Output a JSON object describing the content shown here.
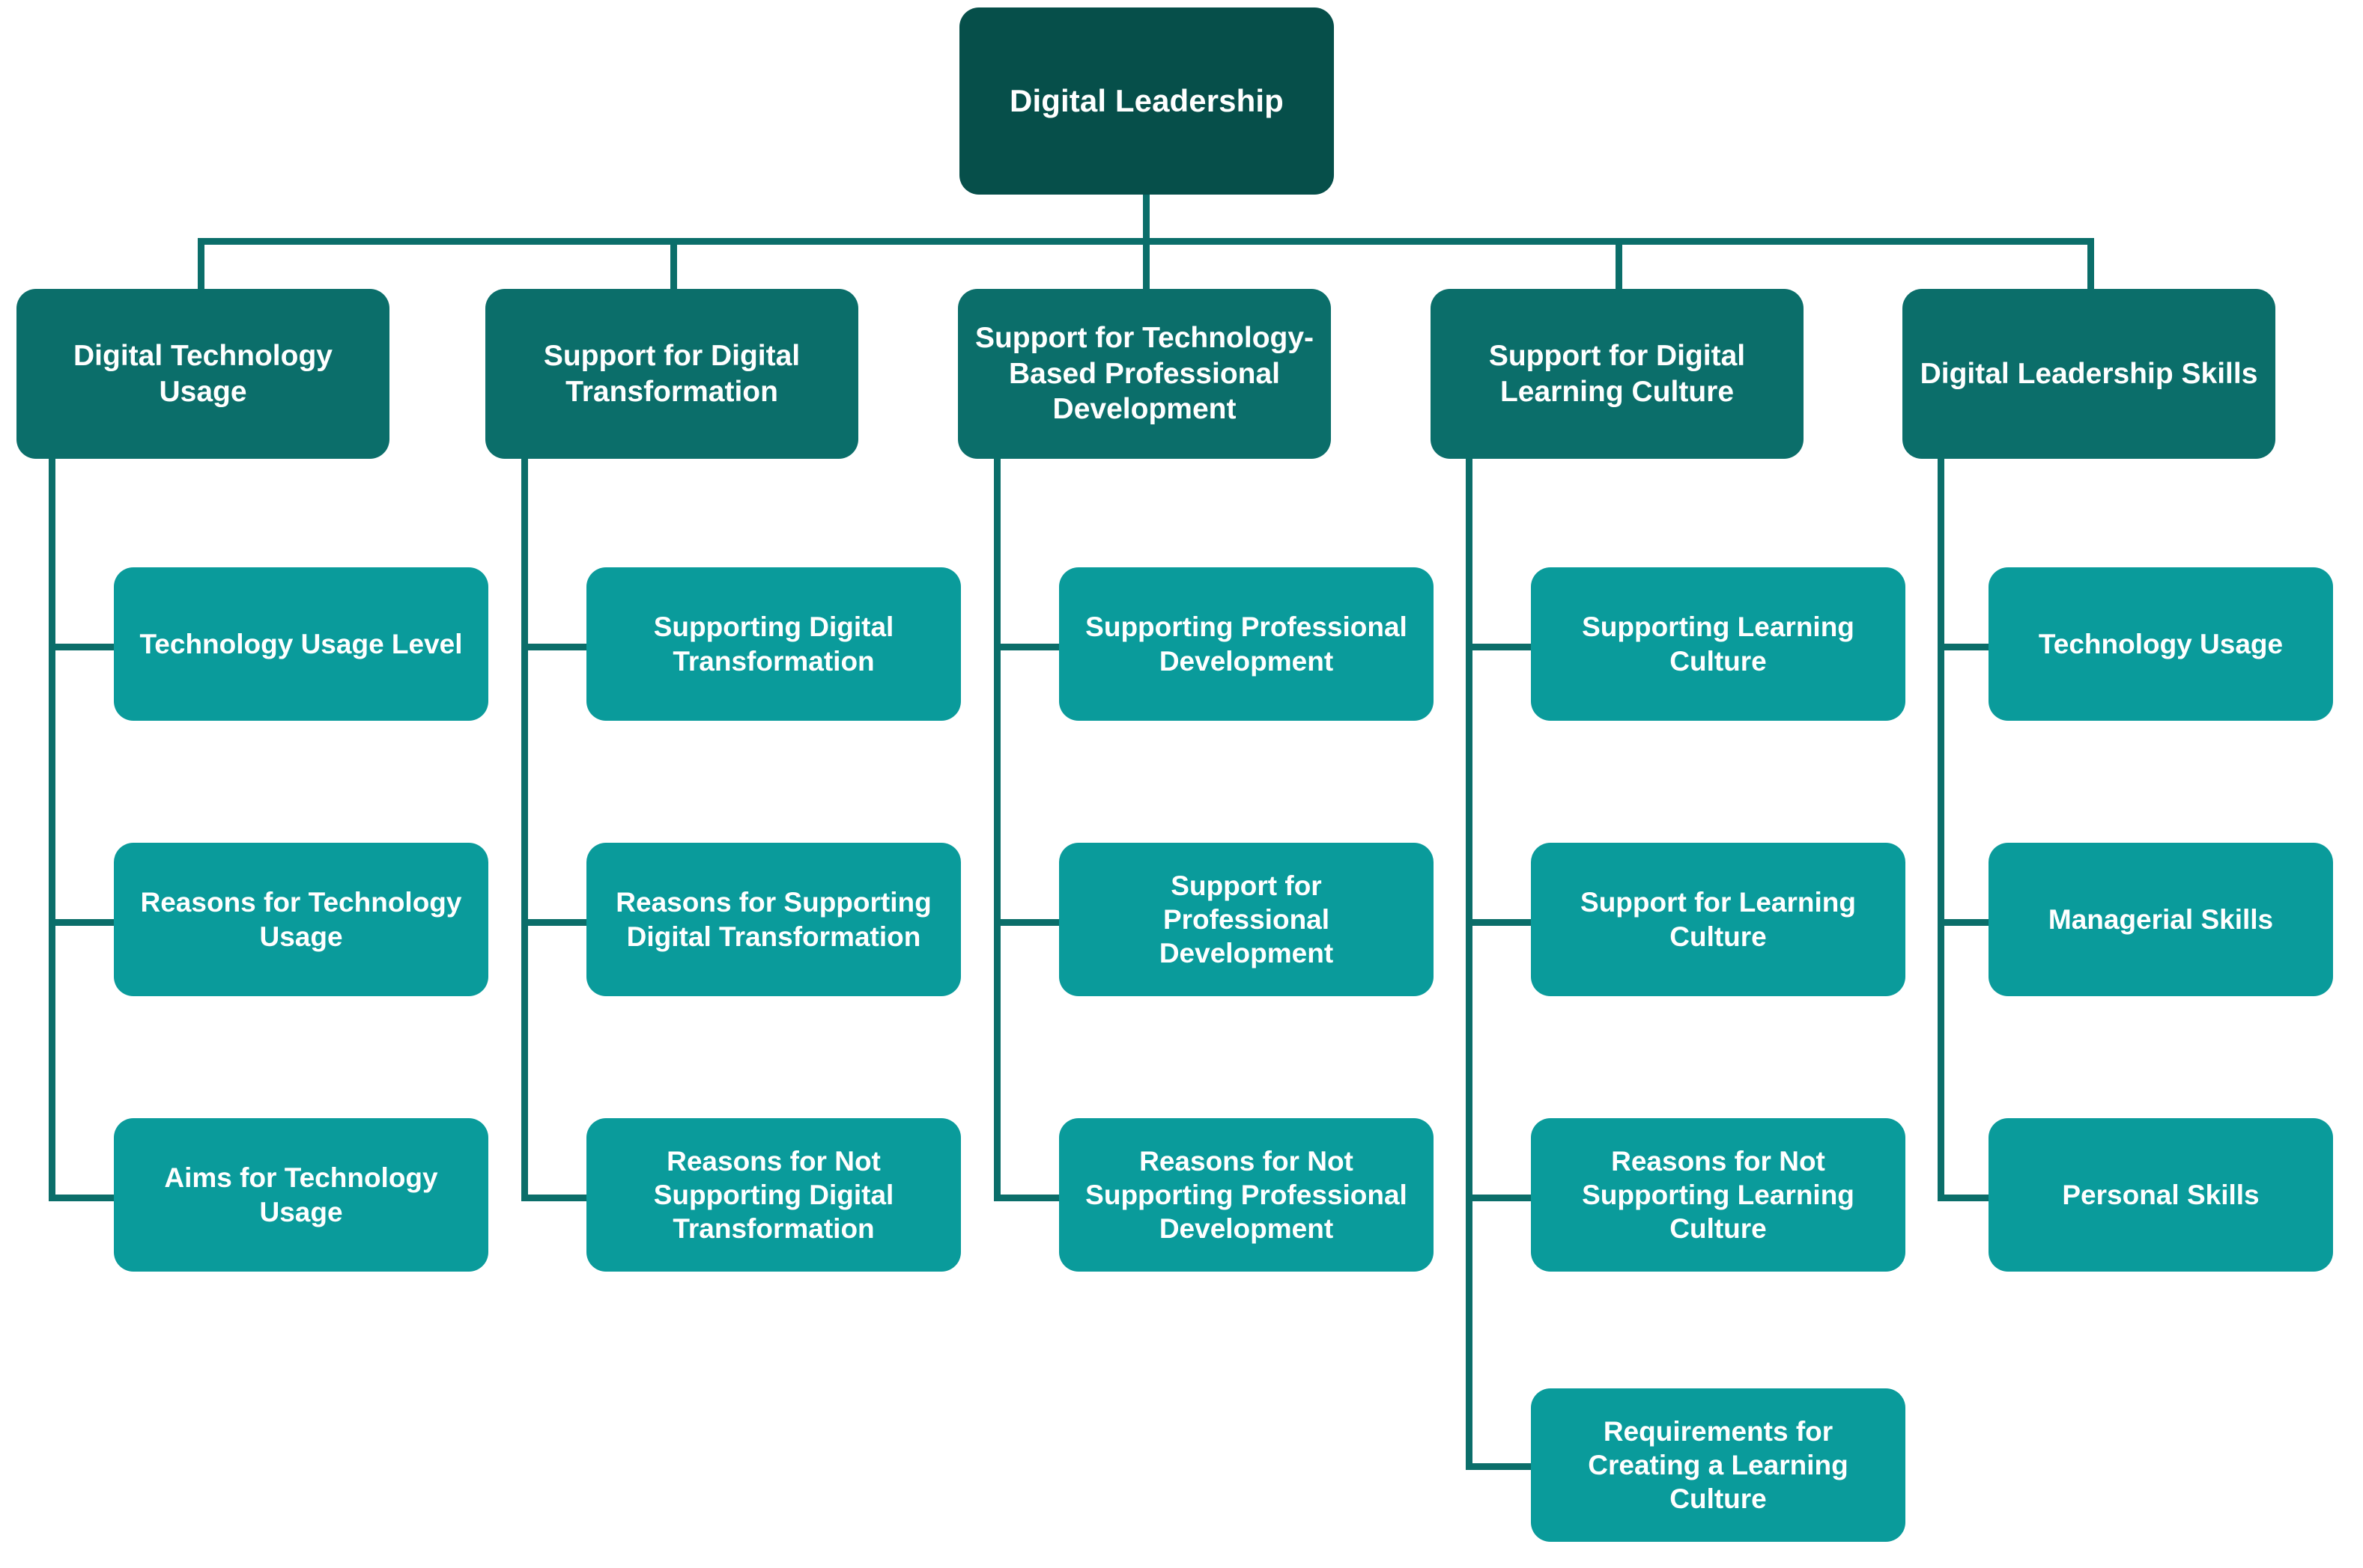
{
  "diagram": {
    "type": "organizational-tree",
    "title_node": "Digital Leadership",
    "colors": {
      "root": "#064f4a",
      "level2": "#0b6e6a",
      "level3": "#0a9b9b",
      "connector": "#0b6e6a",
      "text": "#ffffff",
      "background": "#ffffff"
    },
    "root": {
      "label": "Digital Leadership"
    },
    "branches": [
      {
        "label": "Digital Technology\nUsage",
        "children": [
          {
            "label": "Technology Usage Level"
          },
          {
            "label": "Reasons for Technology\nUsage"
          },
          {
            "label": "Aims for Technology\nUsage"
          }
        ]
      },
      {
        "label": "Support for Digital\nTransformation",
        "children": [
          {
            "label": "Supporting Digital\nTransformation"
          },
          {
            "label": "Reasons for Supporting\nDigital Transformation"
          },
          {
            "label": "Reasons for Not\nSupporting Digital\nTransformation"
          }
        ]
      },
      {
        "label": "Support for Technology-\nBased Professional\nDevelopment",
        "children": [
          {
            "label": "Supporting Professional\nDevelopment"
          },
          {
            "label": "Support for\nProfessional\nDevelopment"
          },
          {
            "label": "Reasons for Not\nSupporting Professional\nDevelopment"
          }
        ]
      },
      {
        "label": "Support for Digital\nLearning Culture",
        "children": [
          {
            "label": "Supporting Learning\nCulture"
          },
          {
            "label": "Support for Learning\nCulture"
          },
          {
            "label": "Reasons for Not\nSupporting Learning\nCulture"
          },
          {
            "label": "Requirements for\nCreating a Learning\nCulture"
          }
        ]
      },
      {
        "label": "Digital Leadership Skills",
        "children": [
          {
            "label": "Technology Usage"
          },
          {
            "label": "Managerial Skills"
          },
          {
            "label": "Personal Skills"
          }
        ]
      }
    ]
  }
}
